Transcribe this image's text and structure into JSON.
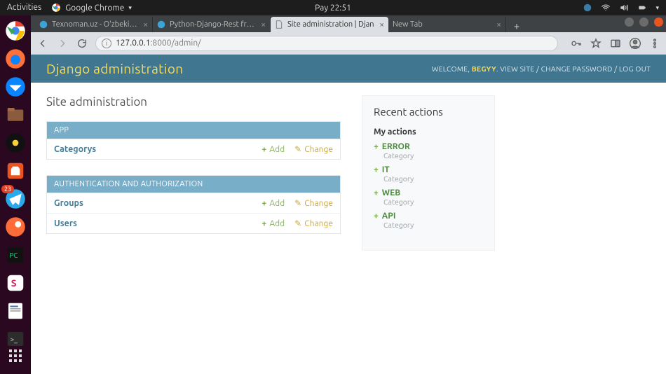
{
  "os": {
    "activities": "Activities",
    "active_app": "Google Chrome",
    "clock": "Pay 22:51"
  },
  "dock": {
    "telegram_badge": "23"
  },
  "browser": {
    "tabs": [
      {
        "title": "Texnoman.uz - O'zbekistc"
      },
      {
        "title": "Python-Django-Rest fram"
      },
      {
        "title": "Site administration | Djan"
      },
      {
        "title": "New Tab"
      }
    ],
    "url_host": "127.0.0.1",
    "url_port_path": ":8000/admin/"
  },
  "page": {
    "brand": "Django administration",
    "welcome_prefix": "WELCOME, ",
    "user": "BEGYY",
    "view_site": "VIEW SITE",
    "change_password": "CHANGE PASSWORD",
    "log_out": "LOG OUT",
    "title": "Site administration",
    "add_label": "Add",
    "change_label": "Change",
    "modules": [
      {
        "caption": "APP",
        "rows": [
          "Categorys"
        ]
      },
      {
        "caption": "AUTHENTICATION AND AUTHORIZATION",
        "rows": [
          "Groups",
          "Users"
        ]
      }
    ],
    "recent_heading": "Recent actions",
    "my_actions": "My actions",
    "recent": [
      {
        "t": "ERROR",
        "s": "Category"
      },
      {
        "t": "IT",
        "s": "Category"
      },
      {
        "t": "WEB",
        "s": "Category"
      },
      {
        "t": "API",
        "s": "Category"
      }
    ]
  }
}
